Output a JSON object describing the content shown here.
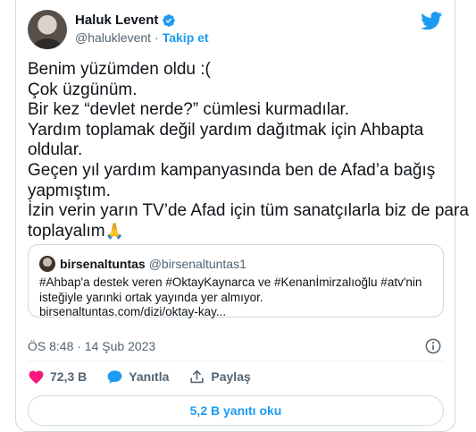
{
  "author": {
    "display_name": "Haluk Levent",
    "handle": "@haluklevent",
    "separator": "·",
    "follow_label": "Takip et"
  },
  "tweet": {
    "lines": [
      "Benim yüzümden oldu :(",
      "Çok üzgünüm.",
      "Bir kez “devlet nerde?” cümlesi kurmadılar.",
      "Yardım toplamak değil yardım dağıtmak için Ahbapta",
      "oldular.",
      "Geçen yıl yardım kampanyasında ben de Afad’a bağış",
      "yapmıştım.",
      "İzin verin yarın TV’de Afad için tüm sanatçılarla biz de para",
      "toplayalım"
    ],
    "emoji": "🙏"
  },
  "quote": {
    "name": "birsenaltuntas",
    "handle": "@birsenaltuntas1",
    "lines": [
      "#Ahbap'a destek veren #OktayKaynarca ve #Kenanİmirzalıoğlu #atv'nin",
      "isteğiyle yarınki ortak yayında yer almıyor.",
      "birsenaltuntas.com/dizi/oktay-kay..."
    ]
  },
  "meta": {
    "timestamp": "ÖS 8:48 · 14 Şub 2023"
  },
  "actions": {
    "likes": "72,3 B",
    "reply": "Yanıtla",
    "share": "Paylaş"
  },
  "replies_button": "5,2 B yanıtı oku",
  "colors": {
    "accent": "#1d9bf0",
    "like": "#f91880",
    "text": "#0f1419",
    "muted": "#536471",
    "border": "#cfd9de"
  },
  "icons": [
    "verified-badge-icon",
    "twitter-bird-icon",
    "info-icon",
    "heart-icon",
    "reply-bubble-icon",
    "share-icon"
  ]
}
